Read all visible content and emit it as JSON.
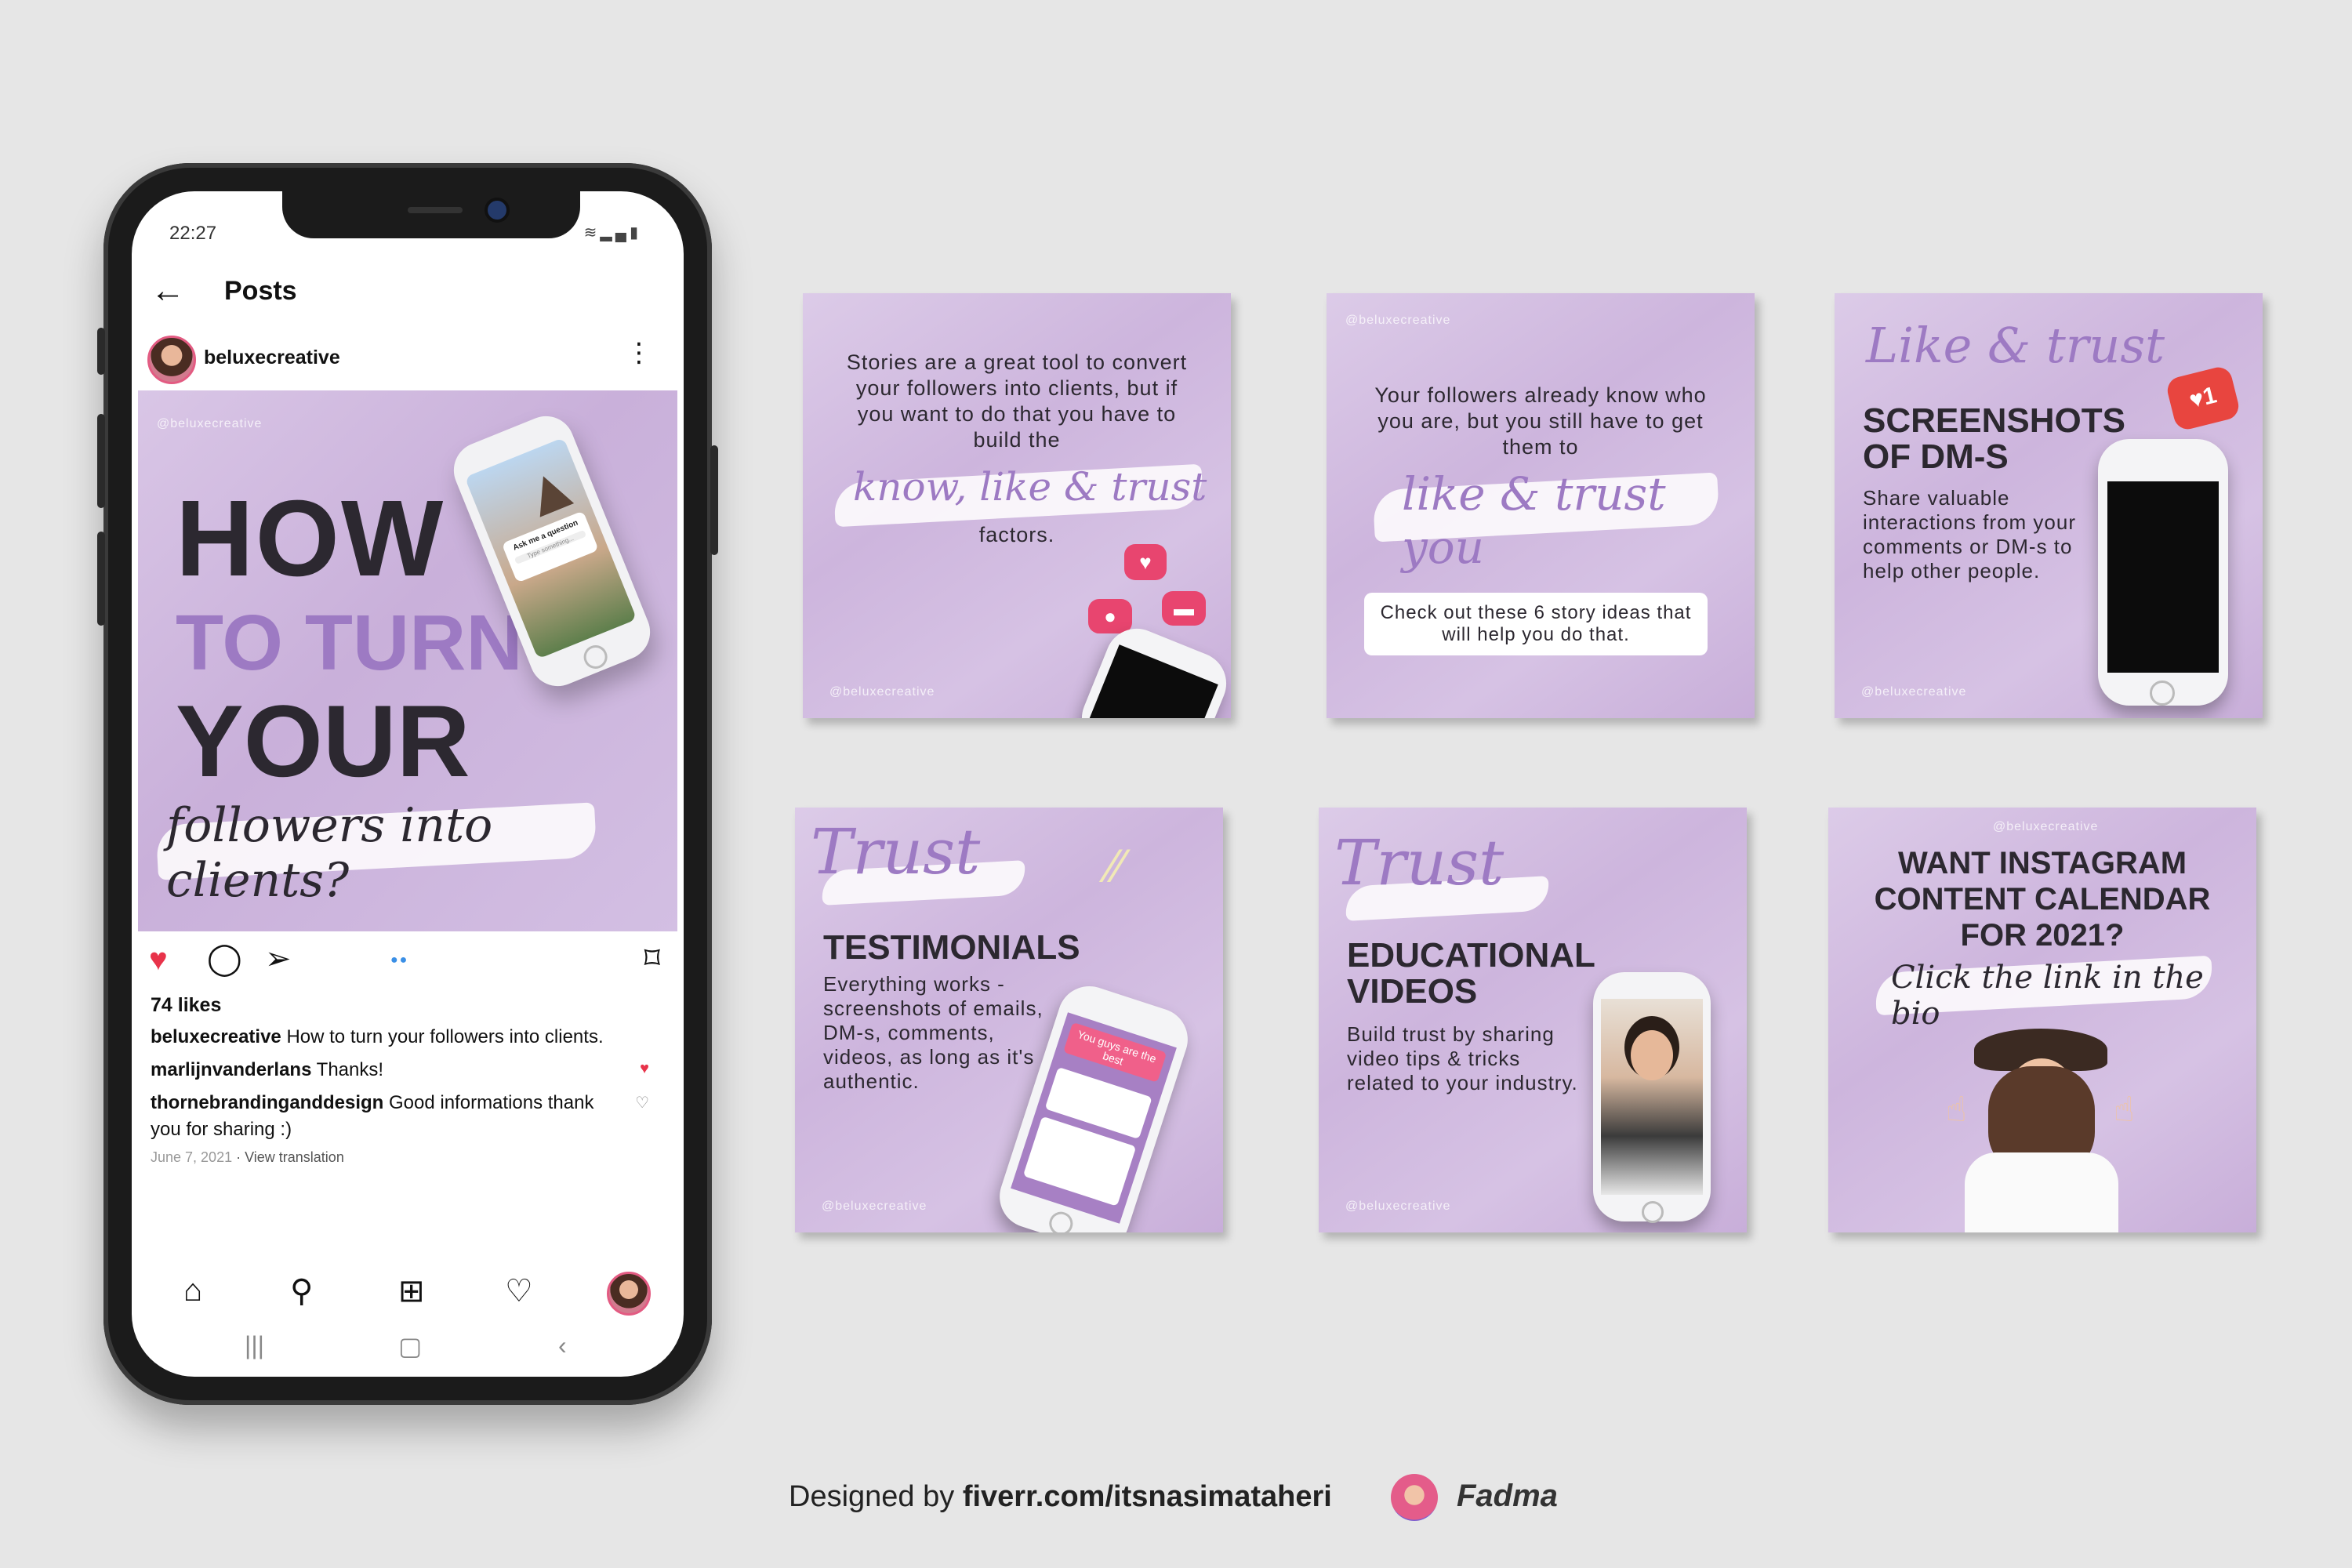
{
  "phone": {
    "status_time": "22:27",
    "status_icons": "wifi-icon signal-icon battery-icon",
    "appbar_title": "Posts",
    "post_user": "beluxecreative",
    "image": {
      "watermark": "@beluxecreative",
      "line1": "HOW",
      "line2": "TO TURN",
      "line3": "YOUR",
      "script": "followers into clients?",
      "mini_phone_text": "Ask me a question",
      "mini_phone_sub": "Type something..."
    },
    "likes": "74 likes",
    "comments": [
      {
        "user": "beluxecreative",
        "text": " How to turn your followers into clients."
      },
      {
        "user": "marlijnvanderlans",
        "text": " Thanks!"
      },
      {
        "user": "thornebrandinganddesign",
        "text": " Good informations thank you for sharing :)"
      }
    ],
    "date": "June 7, 2021",
    "view_translation": "View translation"
  },
  "cards": {
    "card1": {
      "text": "Stories are a great tool to convert your followers into clients, but if you want to do that you have to build the",
      "script": "know, like & trust",
      "end": "factors.",
      "watermark": "@beluxecreative"
    },
    "card2": {
      "watermark": "@beluxecreative",
      "text": "Your followers already know who you are, but you still have to get them to",
      "script": "like & trust you",
      "box": "Check out these 6 story ideas that will help you do that."
    },
    "card3": {
      "script": "Like & trust",
      "title": "SCREENSHOTS OF DM-S",
      "body": "Share valuable interactions from your comments or DM-s to help other people.",
      "notif": "1",
      "watermark": "@beluxecreative"
    },
    "card4": {
      "script": "Trust",
      "title": "TESTIMONIALS",
      "body": "Everything works - screenshots of emails, DM-s, comments, videos, as long as it's authentic.",
      "phone_banner": "You guys are the best",
      "watermark": "@beluxecreative"
    },
    "card5": {
      "script": "Trust",
      "title": "EDUCATIONAL VIDEOS",
      "body": "Build trust by sharing video tips & tricks related to your industry.",
      "watermark": "@beluxecreative"
    },
    "card6": {
      "watermark": "@beluxecreative",
      "title": "WANT INSTAGRAM CONTENT CALENDAR FOR 2021?",
      "script": "Click the link in the bio"
    }
  },
  "footer": {
    "designed_by": "Designed by ",
    "link": "fiverr.com/itsnasimataheri",
    "brand": "Fadma"
  },
  "colors": {
    "accent_purple": "#9d7ac3",
    "card_bg": "#d3bfe3",
    "like_red": "#e8334a",
    "text_dark": "#2c2830"
  }
}
